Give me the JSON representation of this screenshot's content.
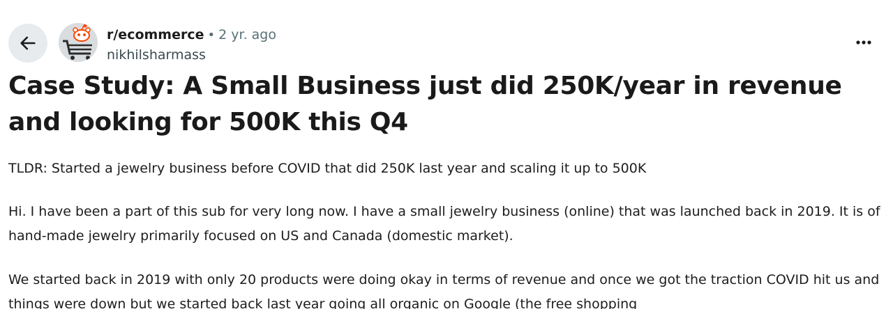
{
  "post": {
    "subreddit": "r/ecommerce",
    "separator": "•",
    "age": "2 yr. ago",
    "author": "nikhilsharmass",
    "title": "Case Study: A Small Business just did 250K/year in revenue and looking for 500K this Q4",
    "paragraphs": [
      "TLDR: Started a jewelry business before COVID that did 250K last year and scaling it up to 500K",
      "Hi. I have been a part of this sub for very long now. I have a small jewelry business (online) that was launched back in 2019. It is of hand-made jewelry primarily focused on US and Canada (domestic market).",
      "We started back in 2019 with only 20 products were doing okay in terms of revenue and once we got the traction COVID hit us and things were down but we started back last year going all organic on Google (the free shopping"
    ]
  },
  "icons": {
    "back": "arrow-left-icon",
    "more": "ellipsis-icon",
    "avatar": "reddit-snoo-cart-icon"
  },
  "colors": {
    "back_bg": "#e8ebee",
    "text": "#1c1c1c",
    "muted": "#576f76",
    "snoo_orange": "#ff4500"
  }
}
